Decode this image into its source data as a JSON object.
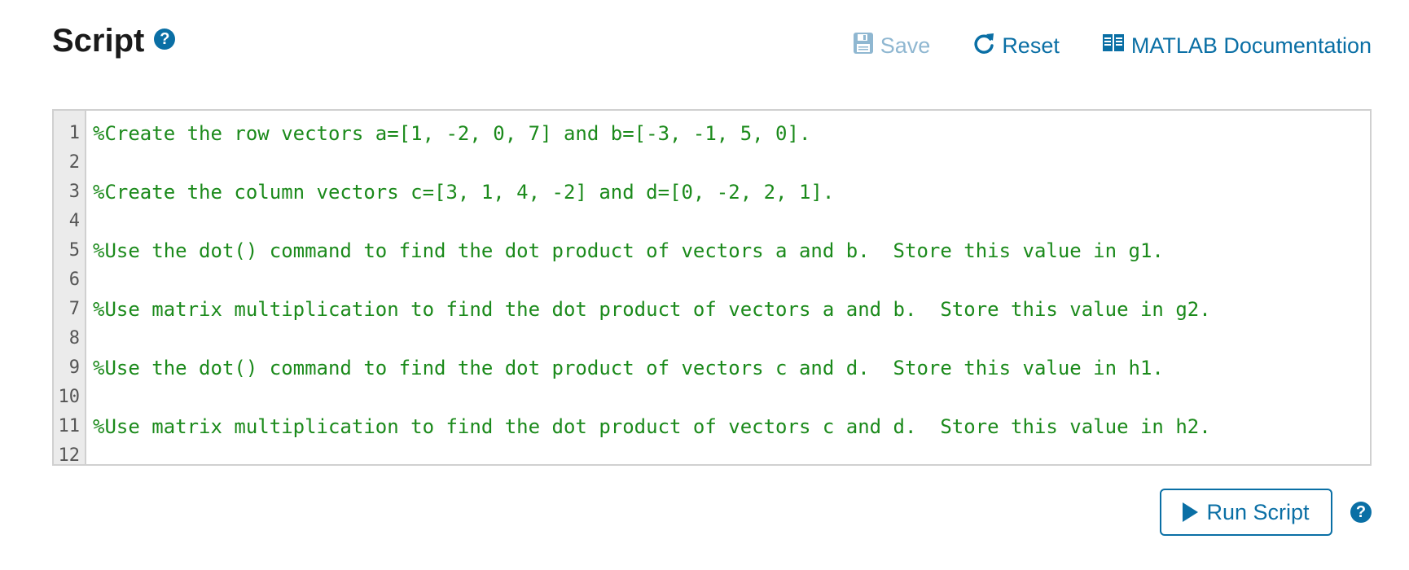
{
  "header": {
    "title": "Script",
    "save_label": "Save",
    "reset_label": "Reset",
    "docs_label": "MATLAB Documentation"
  },
  "icons": {
    "help": "question-circle-icon",
    "save": "floppy-disk-icon",
    "reset": "refresh-icon",
    "docs": "book-icon",
    "run": "play-icon"
  },
  "colors": {
    "accent": "#0a6fa5",
    "comment": "#1b8a1b",
    "disabled": "#8fb7d1",
    "gutter_bg": "#ebebeb"
  },
  "editor": {
    "line_numbers": [
      "1",
      "2",
      "3",
      "4",
      "5",
      "6",
      "7",
      "8",
      "9",
      "10",
      "11",
      "12"
    ],
    "lines": [
      "%Create the row vectors a=[1, -2, 0, 7] and b=[-3, -1, 5, 0].",
      "",
      "%Create the column vectors c=[3, 1, 4, -2] and d=[0, -2, 2, 1].",
      "",
      "%Use the dot() command to find the dot product of vectors a and b.  Store this value in g1.",
      "",
      "%Use matrix multiplication to find the dot product of vectors a and b.  Store this value in g2.",
      "",
      "%Use the dot() command to find the dot product of vectors c and d.  Store this value in h1.",
      "",
      "%Use matrix multiplication to find the dot product of vectors c and d.  Store this value in h2.",
      ""
    ]
  },
  "footer": {
    "run_label": "Run Script"
  }
}
